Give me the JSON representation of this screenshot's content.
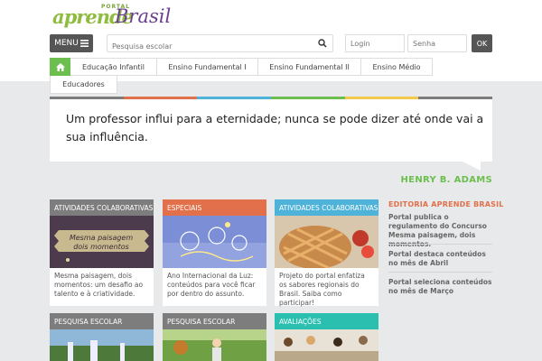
{
  "logo": {
    "portal": "PORTAL",
    "aprende": "aprende",
    "brasil": "Brasil"
  },
  "header": {
    "menu_label": "MENU",
    "search_placeholder": "Pesquisa escolar",
    "login_placeholder": "Login",
    "senha_placeholder": "Senha",
    "ok_label": "OK"
  },
  "nav": {
    "items": [
      {
        "label": "Educação Infantil"
      },
      {
        "label": "Ensino Fundamental I"
      },
      {
        "label": "Ensino Fundamental II"
      },
      {
        "label": "Ensino Médio"
      },
      {
        "label": "Educadores"
      }
    ]
  },
  "quote": {
    "text": "Um professor influi para a eternidade; nunca se pode dizer até onde vai a sua influência.",
    "author": "HENRY B. ADAMS"
  },
  "cards": [
    {
      "category": "ATIVIDADES COLABORATIVAS",
      "image_text_1": "Mesma paisagem",
      "image_text_2": "dois momentos",
      "text": "Mesma paisagem, dois momentos: um desafio ao talento e à criatividade."
    },
    {
      "category": "ESPECIAIS",
      "text": "Ano Internacional da Luz: conteúdos para você ficar por dentro do assunto."
    },
    {
      "category": "ATIVIDADES COLABORATIVAS",
      "text": "Projeto do portal enfatiza os sabores regionais do Brasil. Saiba como participar!"
    },
    {
      "category": "PESQUISA ESCOLAR"
    },
    {
      "category": "PESQUISA ESCOLAR"
    },
    {
      "category": "AVALIAÇÕES"
    }
  ],
  "sidebar": {
    "title": "EDITORIA APRENDE BRASIL",
    "items": [
      {
        "label": "Portal publica o regulamento do Concurso Mesma paisagem, dois momentos."
      },
      {
        "label": "Portal destaca conteúdos no mês de Abril"
      },
      {
        "label": "Portal seleciona conteúdos no mês de Março"
      }
    ]
  },
  "colors": {
    "green": "#6cbf4e",
    "card_gray": "#7d7d7d",
    "card_orange": "#e2704a",
    "card_blue": "#4fb3d9",
    "card_teal": "#2bbfb0",
    "strip": [
      "#7d7d7d",
      "#e2704a",
      "#4fb3d9",
      "#6cbf4e",
      "#f2c94c",
      "#7d7d7d"
    ]
  }
}
